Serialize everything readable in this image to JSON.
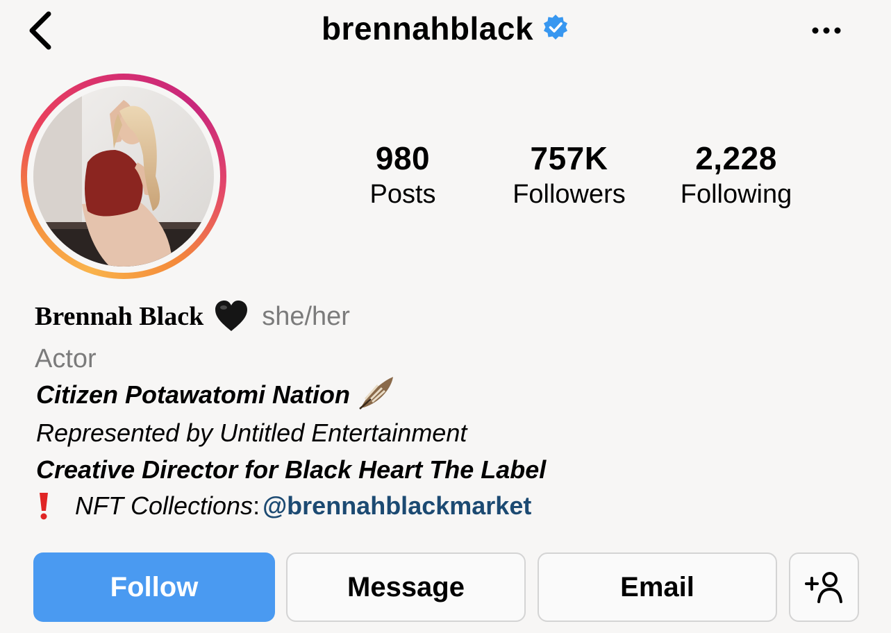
{
  "header": {
    "username": "brennahblack",
    "verified": true,
    "icons": [
      "back-chevron-icon",
      "verified-badge-icon",
      "more-options-icon"
    ],
    "accent_color": "#3897f0"
  },
  "profile": {
    "avatar": "profile-photo",
    "story_ring": true
  },
  "stats": {
    "posts": {
      "value": "980",
      "label": "Posts"
    },
    "followers": {
      "value": "757K",
      "label": "Followers"
    },
    "following": {
      "value": "2,228",
      "label": "Following"
    }
  },
  "bio": {
    "name": "Brennah Black",
    "name_emoji": "black-heart-icon",
    "pronouns": "she/her",
    "category": "Actor",
    "line1": "Citizen Potawatomi Nation",
    "line1_emoji": "feather-icon",
    "line2": "Represented by Untitled Entertainment",
    "line3": "Creative Director for Black Heart The Label",
    "line4_emoji": "exclamation-icon",
    "line4_prefix": "NFT Collections",
    "line4_colon": ":",
    "line4_link": "@brennahblackmarket"
  },
  "actions": {
    "follow": "Follow",
    "message": "Message",
    "email": "Email",
    "add_user": "add-person-icon",
    "follow_color": "#4a9af1"
  }
}
